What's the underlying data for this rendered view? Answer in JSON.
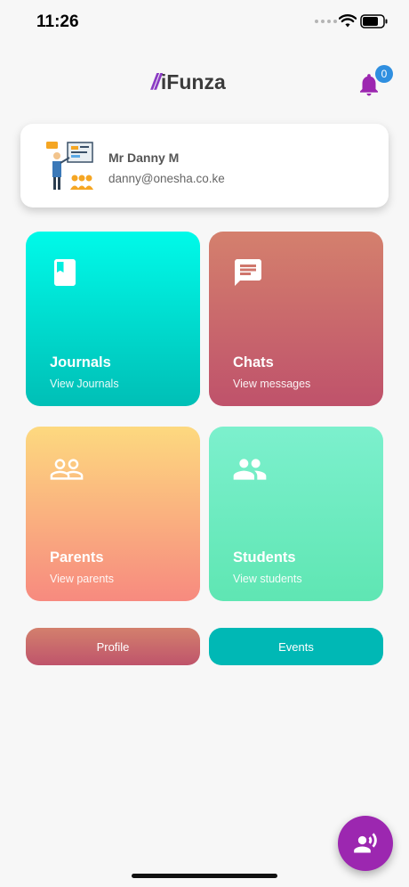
{
  "status_bar": {
    "time": "11:26"
  },
  "header": {
    "logo_slash": "//",
    "logo_text": "iFunza",
    "notification_count": "0"
  },
  "profile": {
    "name": "Mr Danny M",
    "email": "danny@onesha.co.ke"
  },
  "tiles": [
    {
      "title": "Journals",
      "subtitle": "View Journals",
      "icon": "book-icon"
    },
    {
      "title": "Chats",
      "subtitle": "View messages",
      "icon": "chat-icon"
    },
    {
      "title": "Parents",
      "subtitle": "View parents",
      "icon": "people-outline-icon"
    },
    {
      "title": "Students",
      "subtitle": "View students",
      "icon": "people-icon"
    }
  ],
  "buttons": {
    "profile": "Profile",
    "events": "Events"
  },
  "fab": {
    "icon": "voice-person-icon"
  },
  "colors": {
    "accent": "#9c27b0",
    "badge": "#2f8fe0",
    "teal": "#00b8b5"
  }
}
